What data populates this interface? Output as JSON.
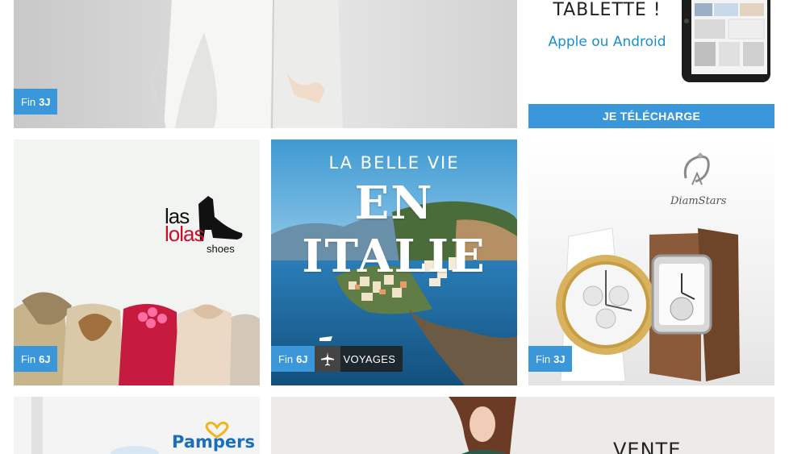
{
  "tiles": [
    {
      "name": "tile-knit-cardigan",
      "fin_label": "Fin",
      "days": "3J"
    },
    {
      "name": "tile-tablet-app",
      "title": "TABLETTE !",
      "subtitle": "Apple ou Android",
      "cta": "JE TÉLÉCHARGE"
    },
    {
      "name": "tile-las-lolas",
      "brand_line1": "las",
      "brand_line2": "lolas",
      "brand_line3": "shoes",
      "fin_label": "Fin",
      "days": "6J"
    },
    {
      "name": "tile-italie",
      "headline1": "LA BELLE VIE",
      "headline2": "EN ITALIE",
      "fin_label": "Fin",
      "days": "6J",
      "category": "VOYAGES"
    },
    {
      "name": "tile-diamstars",
      "brand": "DiamStars",
      "fin_label": "Fin",
      "days": "3J"
    },
    {
      "name": "tile-pampers",
      "brand": "Pampers"
    },
    {
      "name": "tile-vente",
      "headline": "VENTE"
    }
  ],
  "colors": {
    "badge_blue": "#3a97d9",
    "sea_blue": "#1f6fa6"
  },
  "icons": {
    "travel": "airplane-icon"
  }
}
